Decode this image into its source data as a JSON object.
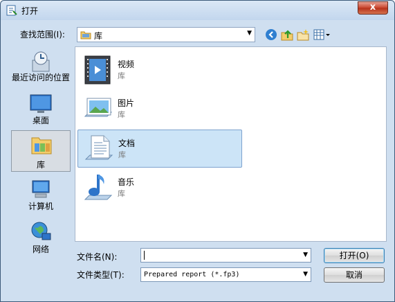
{
  "window": {
    "title": "打开",
    "close_symbol": "x"
  },
  "toolbar": {
    "lookin_label": "查找范围(I):",
    "lookin_value": "库",
    "icons": [
      "back-icon",
      "up-folder-icon",
      "new-folder-icon",
      "view-menu-icon"
    ]
  },
  "places": [
    {
      "label": "最近访问的位置",
      "icon": "recent-places-icon"
    },
    {
      "label": "桌面",
      "icon": "desktop-icon"
    },
    {
      "label": "库",
      "icon": "libraries-icon",
      "selected": true
    },
    {
      "label": "计算机",
      "icon": "computer-icon"
    },
    {
      "label": "网络",
      "icon": "network-icon"
    }
  ],
  "items": [
    {
      "name": "视频",
      "sub": "库",
      "icon": "videos-library-icon"
    },
    {
      "name": "图片",
      "sub": "库",
      "icon": "pictures-library-icon"
    },
    {
      "name": "文档",
      "sub": "库",
      "icon": "documents-library-icon",
      "selected": true
    },
    {
      "name": "音乐",
      "sub": "库",
      "icon": "music-library-icon"
    }
  ],
  "filename": {
    "label": "文件名(N):",
    "value": ""
  },
  "filetype": {
    "label": "文件类型(T):",
    "value": "Prepared report (*.fp3)"
  },
  "buttons": {
    "open": "打开(O)",
    "cancel": "取消"
  },
  "colors": {
    "window_bg": "#cfdff0",
    "selection": "#cce4f7",
    "close_red": "#c8432b"
  }
}
